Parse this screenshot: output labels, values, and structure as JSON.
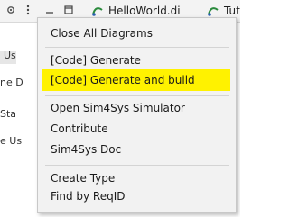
{
  "tabs": [
    {
      "label": "HelloWorld.di",
      "icon": "diagram-file-icon"
    },
    {
      "label": "Tuto",
      "icon": "diagram-file-icon"
    }
  ],
  "background_panel": {
    "rows": [
      "Us",
      "ne D",
      "Sta",
      "e Us"
    ]
  },
  "menu": {
    "highlight_color": "#fff200",
    "items": [
      {
        "label": "Close All Diagrams"
      },
      {
        "label": "[Code] Generate"
      },
      {
        "label": "[Code] Generate and build"
      },
      {
        "label": "Open Sim4Sys Simulator"
      },
      {
        "label": "Contribute"
      },
      {
        "label": "Sim4Sys Doc"
      },
      {
        "label": "Create Type"
      },
      {
        "label": "Find by ReqID"
      }
    ]
  }
}
